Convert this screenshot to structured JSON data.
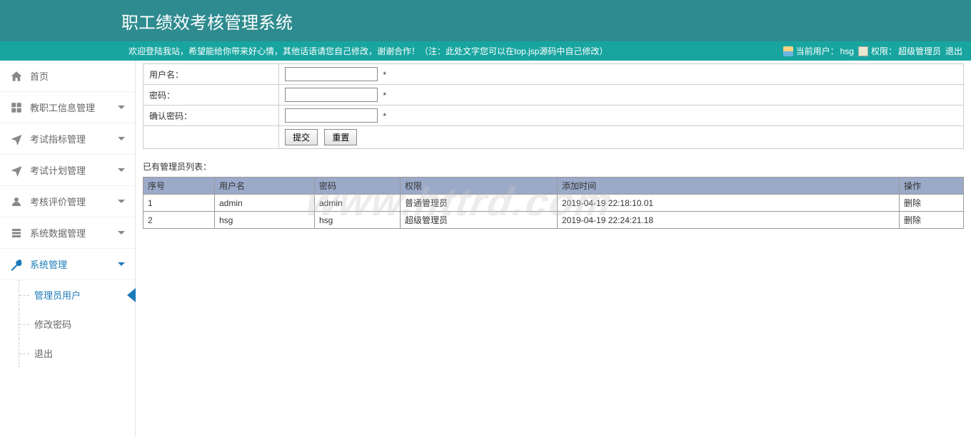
{
  "header": {
    "title": "职工绩效考核管理系统"
  },
  "subheader": {
    "welcome": "欢迎登陆我站，希望能给你带来好心情，其他话语请您自己修改，谢谢合作！（注：此处文字您可以在top.jsp源码中自己修改）",
    "user_label": "当前用户：",
    "user_value": "hsg",
    "role_label": "权限：",
    "role_value": "超级管理员",
    "logout": "退出"
  },
  "sidebar": {
    "items": [
      {
        "label": "首页",
        "icon": "home",
        "expandable": false
      },
      {
        "label": "教职工信息管理",
        "icon": "grid",
        "expandable": true
      },
      {
        "label": "考试指标管理",
        "icon": "plane",
        "expandable": true
      },
      {
        "label": "考试计划管理",
        "icon": "plane",
        "expandable": true
      },
      {
        "label": "考核评价管理",
        "icon": "users",
        "expandable": true
      },
      {
        "label": "系统数据管理",
        "icon": "db",
        "expandable": true
      },
      {
        "label": "系统管理",
        "icon": "wrench",
        "expandable": true,
        "active": true
      }
    ],
    "submenu": [
      {
        "label": "管理员用户",
        "selected": true
      },
      {
        "label": "修改密码",
        "selected": false
      },
      {
        "label": "退出",
        "selected": false
      }
    ]
  },
  "form": {
    "username_label": "用户名：",
    "password_label": "密码：",
    "confirm_label": "确认密码：",
    "username_value": "",
    "password_value": "",
    "confirm_value": "",
    "submit_label": "提交",
    "reset_label": "重置"
  },
  "list_title": "已有管理员列表：",
  "table": {
    "headers": [
      "序号",
      "用户名",
      "密码",
      "权限",
      "添加时间",
      "操作"
    ],
    "rows": [
      {
        "seq": "1",
        "user": "admin",
        "pwd": "admin",
        "role": "普通管理员",
        "time": "2019-04-19 22:18:10.01",
        "op": "删除"
      },
      {
        "seq": "2",
        "user": "hsg",
        "pwd": "hsg",
        "role": "超级管理员",
        "time": "2019-04-19 22:24:21.18",
        "op": "删除"
      }
    ]
  },
  "watermark": "www.httrd.com"
}
